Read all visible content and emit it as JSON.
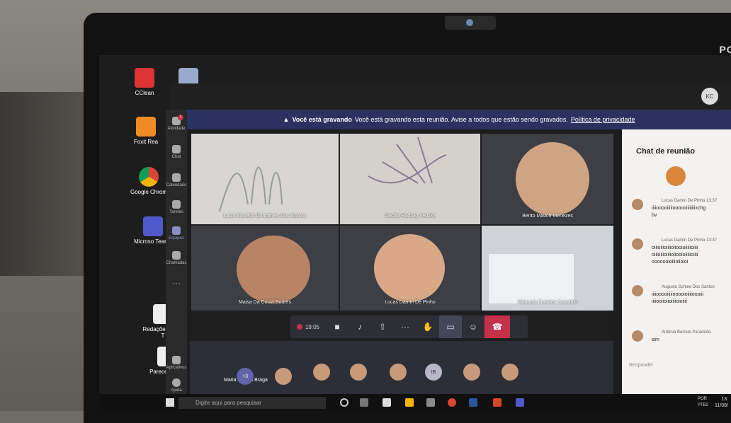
{
  "desktop": {
    "icons": [
      "CClean",
      "Foxit Rea",
      "Google Chrom",
      "Microso Teams",
      "Redações Ano - T",
      "Parecer Afetiv"
    ]
  },
  "teams_rail": [
    "Atividade",
    "Chat",
    "Calendário",
    "Tarefas",
    "Equipes",
    "Chamadas",
    "Aplicativos",
    "Ajuda"
  ],
  "rail_badge": "1",
  "banner": {
    "bold": "Você está gravando",
    "text": "Você está gravando esta reunião. Avise a todos que estão sendo gravados.",
    "link": "Política de privacidade"
  },
  "tiles": [
    {
      "name": "Luiza Macedo Gonçalves Dos Santos"
    },
    {
      "name": "Cecília Hartwig Venzke"
    },
    {
      "name": "Bento Mauch Menezes"
    },
    {
      "name": "Maisa Da Costa Soares"
    },
    {
      "name": "Lucas Damin De Pinho"
    },
    {
      "name": "Manuela Fuentes Carvalho"
    }
  ],
  "strip": {
    "name": "Maria França Braga",
    "overflow": "+3",
    "initials": "IB"
  },
  "callbar": {
    "time": "19:05"
  },
  "chat": {
    "title": "Chat de reunião",
    "messages": [
      {
        "author": "Lucas Damin De Pinho",
        "time": "13:37",
        "text": "iiiiooooiiiiioooooiiiiiiiixchg\nbv"
      },
      {
        "author": "Lucas Damin De Pinho",
        "time": "13:37",
        "text": "oiiioiiioiiiioiiooioiiiiioiiii\noiiioiiioiiiioiiooioiiiiioiiii\nooooooioiiioiioioi"
      },
      {
        "author": "Augusto Schlee Dos Santos",
        "time": "",
        "text": "iiiiooooiiiiiooooioiiiioooiii\niiiiooiioiioiiiioioiiii"
      },
      {
        "author": "Antônia Berreto Paradeda",
        "time": "",
        "text": "sim"
      }
    ],
    "reply_placeholder": "Responder"
  },
  "taskbar": {
    "search_placeholder": "Digite aqui para pesquisar",
    "lang": "POR",
    "layout": "PTB2",
    "time": "13:",
    "date": "11/08/"
  },
  "brand": "POS"
}
